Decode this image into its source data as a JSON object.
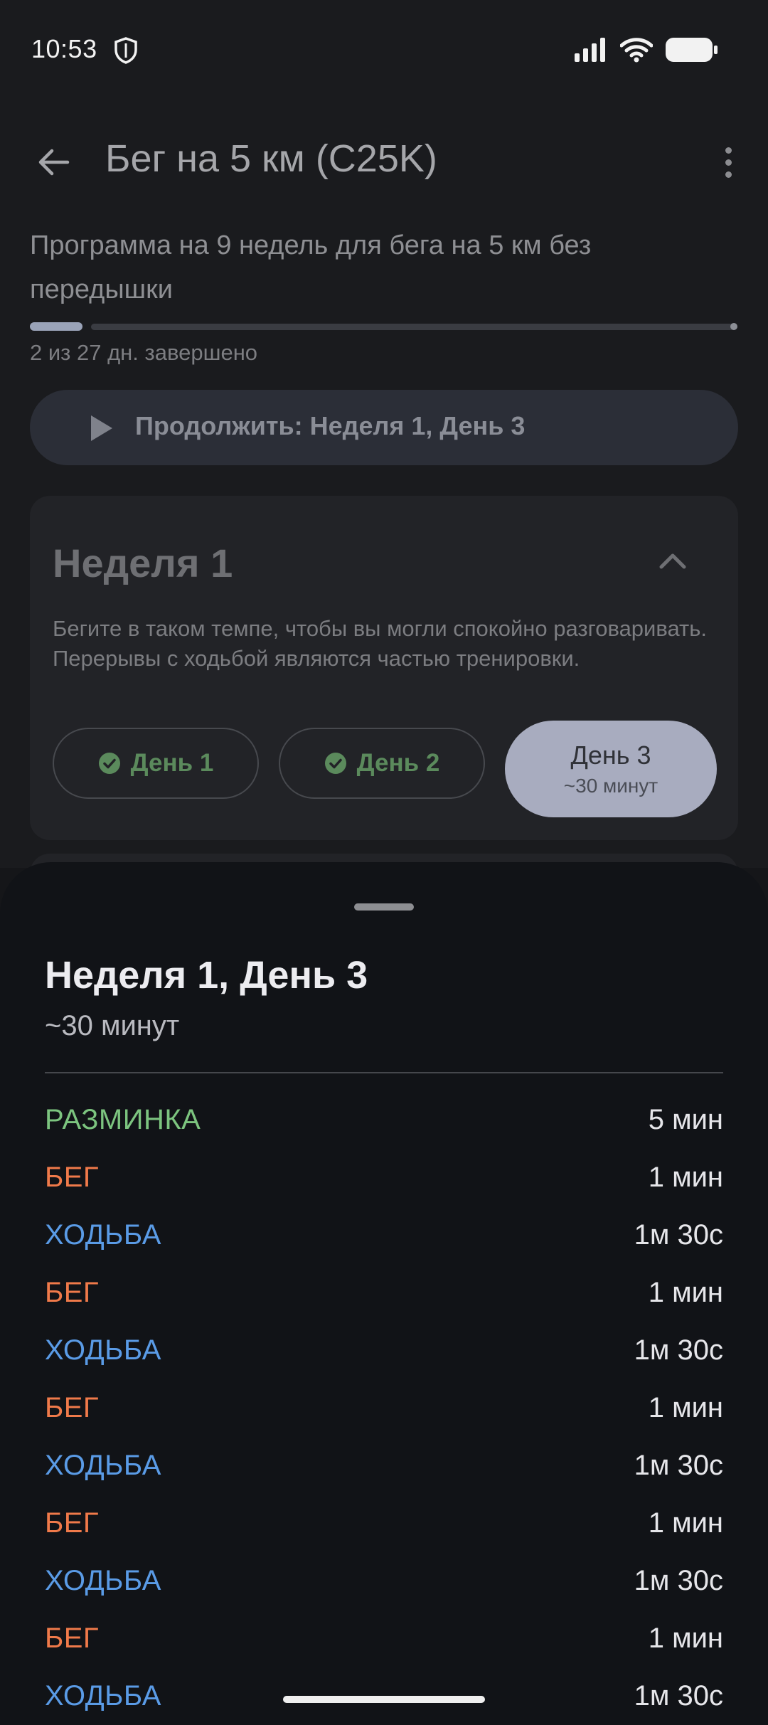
{
  "status_bar": {
    "time": "10:53",
    "icons": [
      "shield-icon",
      "signal-icon",
      "wifi-icon",
      "battery-icon"
    ]
  },
  "app_bar": {
    "title": "Бег на 5 км (C25K)",
    "back_icon": "arrow-left-icon",
    "more_icon": "more-vert-icon"
  },
  "program": {
    "description": "Программа на 9 недель для бега на 5 км без передышки",
    "progress_label": "2 из 27 дн. завершено",
    "progress_fraction": 0.074,
    "continue_label": "Продолжить: Неделя 1, День 3"
  },
  "week": {
    "title": "Неделя 1",
    "description": "Бегите в таком темпе, чтобы вы могли спокойно разговаривать. Перерывы с ходьбой являются частью тренировки.",
    "days": [
      {
        "label": "День 1",
        "completed": true
      },
      {
        "label": "День 2",
        "completed": true
      },
      {
        "label": "День 3",
        "completed": false,
        "duration": "~30 минут"
      }
    ]
  },
  "sheet": {
    "title": "Неделя 1, День 3",
    "subtitle": "~30 минут",
    "steps": [
      {
        "name": "РАЗМИНКА",
        "duration": "5 мин",
        "color": "#7cc47f"
      },
      {
        "name": "БЕГ",
        "duration": "1 мин",
        "color": "#f07a4a"
      },
      {
        "name": "ХОДЬБА",
        "duration": "1м 30с",
        "color": "#5a9be6"
      },
      {
        "name": "БЕГ",
        "duration": "1 мин",
        "color": "#f07a4a"
      },
      {
        "name": "ХОДЬБА",
        "duration": "1м 30с",
        "color": "#5a9be6"
      },
      {
        "name": "БЕГ",
        "duration": "1 мин",
        "color": "#f07a4a"
      },
      {
        "name": "ХОДЬБА",
        "duration": "1м 30с",
        "color": "#5a9be6"
      },
      {
        "name": "БЕГ",
        "duration": "1 мин",
        "color": "#f07a4a"
      },
      {
        "name": "ХОДЬБА",
        "duration": "1м 30с",
        "color": "#5a9be6"
      },
      {
        "name": "БЕГ",
        "duration": "1 мин",
        "color": "#f07a4a"
      },
      {
        "name": "ХОДЬБА",
        "duration": "1м 30с",
        "color": "#5a9be6"
      }
    ]
  },
  "colors": {
    "completed_green": "#5b8a5c",
    "active_chip": "#a8acbf",
    "progress_fill": "#9aa3b8"
  }
}
